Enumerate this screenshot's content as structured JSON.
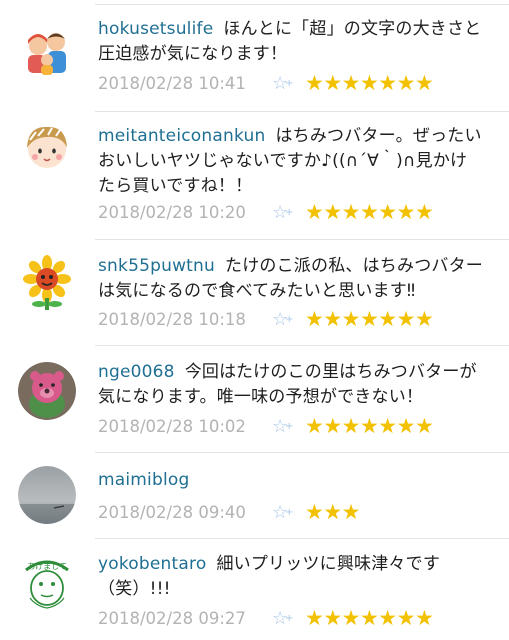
{
  "comments": [
    {
      "username": "hokusetsulife",
      "text": "ほんとに「超」の文字の大きさと圧迫感が気になります！",
      "timestamp": "2018/02/28 10:41",
      "stars": "★★★★★★★",
      "avatar_icon": "family-avatar-icon"
    },
    {
      "username": "meitanteiconankun",
      "text": "はちみつバター。ぜったいおいしいヤツじゃないですか♪((∩´∀｀)∩見かけたら買いですね！！",
      "timestamp": "2018/02/28 10:20",
      "stars": "★★★★★★★",
      "avatar_icon": "girl-face-avatar-icon"
    },
    {
      "username": "snk55puwtnu",
      "text": "たけのこ派の私、はちみつバターは気になるので食べてみたいと思います‼",
      "timestamp": "2018/02/28 10:18",
      "stars": "★★★★★★★",
      "avatar_icon": "sunflower-avatar-icon"
    },
    {
      "username": "nge0068",
      "text": "今回はたけのこの里はちみつバターが気になります。唯一味の予想ができない！",
      "timestamp": "2018/02/28 10:02",
      "stars": "★★★★★★★",
      "avatar_icon": "pink-bear-avatar-icon"
    },
    {
      "username": "maimiblog",
      "text": "",
      "timestamp": "2018/02/28 09:40",
      "stars": "★★★",
      "avatar_icon": "sky-avatar-icon"
    },
    {
      "username": "yokobentaro",
      "text": "細いプリッツに興味津々です（笑）!!!",
      "timestamp": "2018/02/28 09:27",
      "stars": "★★★★★★★",
      "avatar_icon": "sketch-face-avatar-icon"
    }
  ],
  "fav_icon": "star-plus-icon",
  "colors": {
    "username": "#1f6f93",
    "timestamp": "#b3b3b3",
    "star": "#f2c100",
    "fav": "#a9c7e8",
    "separator": "#e4e4e4"
  }
}
